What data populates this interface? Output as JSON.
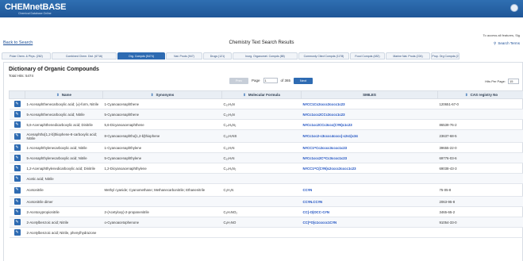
{
  "header": {
    "brand": "CHEMnetBASE",
    "brand_sub": "Chemical Database Online"
  },
  "access_text": "To access all features, Sig",
  "back_link": "Back to Search",
  "page_title": "Chemistry Text Search Results",
  "search_terms_label": "Search Terms",
  "tabs": [
    {
      "label": "Polar Chem. & Phys. (262)"
    },
    {
      "label": "Combined Chem. Dict. (6716)"
    },
    {
      "label": "Org. Compds (5474)"
    },
    {
      "label": "Nat. Prods (947)"
    },
    {
      "label": "Drugs (121)"
    },
    {
      "label": "Inorg. Organomet. Compds (88)"
    },
    {
      "label": "Commonly Cited Compds (1178)"
    },
    {
      "label": "Food Compds (482)"
    },
    {
      "label": "Marine Nat. Prods (224)"
    },
    {
      "label": "Prop. Org Compds (2"
    }
  ],
  "dictionary": {
    "title": "Dictionary of Organic Compounds",
    "total_hits": "Total Hits: 5474"
  },
  "pager": {
    "prev_label": "Prev",
    "page_label": "Page",
    "page_value": "1",
    "of_label": "of 365",
    "next_label": "Next"
  },
  "hits_per_page": {
    "label": "Hits Per Page:",
    "value": "15"
  },
  "columns": {
    "name": "Name",
    "synonyms": "Synonyms",
    "formula": "Molecular Formula",
    "smiles": "SMILES",
    "cas": "CAS registry No"
  },
  "rows": [
    {
      "name": "1-Acenaphthenecarboxylic acid; (±)-form, Nitrile",
      "synonyms": "1-Cyanoacenaphthene",
      "formula": "C₁₃H₉N",
      "smiles": "N#CC1Cc2cccc3cccc1c23",
      "cas": "120651-67-0"
    },
    {
      "name": "5-Acenaphthenecarboxylic acid; Nitrile",
      "synonyms": "5-Cyanoacenaphthene",
      "formula": "C₁₃H₉N",
      "smiles": "N#Cc1ccc2CCc3cccc1c23",
      "cas": ""
    },
    {
      "name": "5,6-Acenaphthenedicarboxylic acid; Dinitrile",
      "synonyms": "5,6-Dicyanoacenaphthene",
      "formula": "C₁₄H₈N₂",
      "smiles": "N#Cc1cc2CCc3ccc(C#N)c1c23",
      "cas": "86539-76-2"
    },
    {
      "name": "Acenaphtho[1,2-b]thiophene-8-carboxylic acid; Nitrile",
      "synonyms": "8-Cyanoacenaphtho[1,2-b]thiophene",
      "formula": "C₁₅H₇NS",
      "smiles": "N#Cc1cc2-c3cccc4cccc(-c2s1)c34",
      "cas": "23637-68-5"
    },
    {
      "name": "1-Acenaphthylenecarboxylic acid; Nitrile",
      "synonyms": "1-Cyanoacenaphthylene",
      "formula": "C₁₃H₇N",
      "smiles": "N#CC1=Cc2cccc3cccc1c23",
      "cas": "39655-22-0"
    },
    {
      "name": "5-Acenaphthylenecarboxylic acid; Nitrile",
      "synonyms": "5-Cyanoacenaphthylene",
      "formula": "C₁₃H₇N",
      "smiles": "N#Cc1ccc2C=Cc3cccc1c23",
      "cas": "69776-03-6"
    },
    {
      "name": "1,2-Acenaphthylenedicarboxylic acid; Dinitrile",
      "synonyms": "1,2-Dicyanoacenaphthylene",
      "formula": "C₁₄H₆N₂",
      "smiles": "N#CC1=C(C#N)c2cccc3cccc1c23",
      "cas": "69038-43-3"
    },
    {
      "name": "Acetic acid; Nitrile",
      "synonyms": "",
      "formula": "",
      "smiles": "",
      "cas": ""
    },
    {
      "name": "Acetonitrile",
      "synonyms": "Methyl cyanide; Cyanomethane; Methanecarbonitrile; Ethanenitrile",
      "formula": "C₂H₃N",
      "smiles": "CC#N",
      "cas": "75-05-8"
    },
    {
      "name": "Acetonitrile dimer",
      "synonyms": "",
      "formula": "",
      "smiles": "CC#N.CC#N",
      "cas": "2063-95-8"
    },
    {
      "name": "2-Acetoxypropionitrile",
      "synonyms": "2-(Acetyloxy)-2-propanenitrile",
      "formula": "C₅H₇NO₂",
      "smiles": "CC(-O)OCC-C#N",
      "cas": "3465-65-2"
    },
    {
      "name": "2-Acetylbenzoic acid; Nitrile",
      "synonyms": "o-Cyanoacetophenone",
      "formula": "C₉H₇NO",
      "smiles": "CC(=O)c1ccccc1C#N",
      "cas": "91054-33-0"
    },
    {
      "name": "2-Acetylbenzoic acid; Nitrile, phenylhydrazone",
      "synonyms": "",
      "formula": "",
      "smiles": "",
      "cas": ""
    }
  ],
  "colors": {
    "brand_blue": "#1f5697",
    "accent": "#2e6bb2",
    "smiles_link": "#1a4ec0"
  },
  "icons": {
    "edit": "edit-icon",
    "sort": "sort-icon",
    "search": "search-icon"
  }
}
